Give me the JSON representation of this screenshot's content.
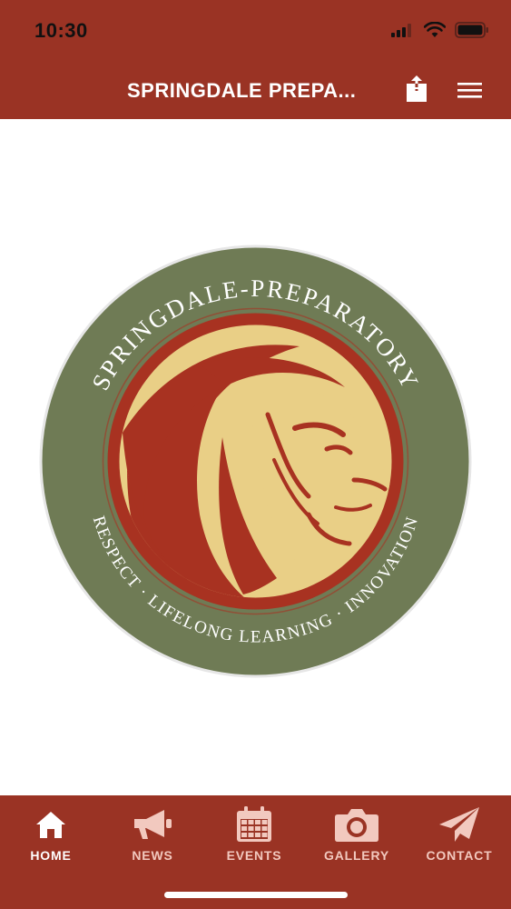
{
  "colors": {
    "brand": "#9a3324",
    "olive": "#6f7b55",
    "gold": "#e9cf86",
    "lion_red": "#a83221"
  },
  "status_bar": {
    "time": "10:30",
    "icons": [
      "signal-icon",
      "wifi-icon",
      "battery-icon"
    ]
  },
  "header": {
    "title": "SPRINGDALE PREPA...",
    "share_icon": "share-icon",
    "menu_icon": "hamburger-menu-icon"
  },
  "logo": {
    "top_text": "SPRINGDALE-PREPARATORY",
    "bottom_text": "RESPECT · LIFELONG LEARNING · INNOVATION",
    "emblem": "lion-head"
  },
  "tabs": [
    {
      "label": "HOME",
      "icon": "home-icon",
      "active": true
    },
    {
      "label": "NEWS",
      "icon": "megaphone-icon",
      "active": false
    },
    {
      "label": "EVENTS",
      "icon": "calendar-icon",
      "active": false
    },
    {
      "label": "GALLERY",
      "icon": "camera-icon",
      "active": false
    },
    {
      "label": "CONTACT",
      "icon": "paper-plane-icon",
      "active": false
    }
  ]
}
